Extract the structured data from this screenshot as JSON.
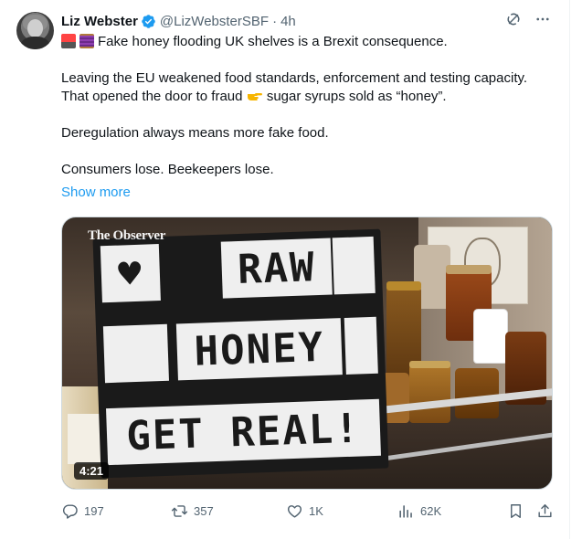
{
  "post": {
    "author_name": "Liz Webster",
    "handle": "@LizWebsterSBF",
    "separator": "·",
    "time": "4h",
    "line1": "Fake honey flooding UK shelves is a Brexit consequence.",
    "para2_before": "Leaving the EU weakened food standards, enforcement and testing capacity. That opened the door to fraud",
    "para2_after": "sugar syrups sold as “honey”.",
    "para3": "Deregulation always means more fake food.",
    "para4": "Consumers lose. Beekeepers lose.",
    "show_more": "Show more"
  },
  "media": {
    "watermark": "The Observer",
    "sign_rows": [
      "RAW",
      "HONEY",
      "GET REAL!"
    ],
    "duration": "4:21"
  },
  "actions": {
    "replies": "197",
    "reposts": "357",
    "likes": "1K",
    "views": "62K"
  },
  "colors": {
    "accent": "#1d9bf0",
    "muted": "#536471",
    "text": "#0f1419"
  },
  "icons": [
    "verified-badge-icon",
    "grok-icon",
    "more-icon",
    "siren-emoji-icon",
    "spool-emoji-icon",
    "pointing-hand-emoji-icon",
    "reply-icon",
    "repost-icon",
    "like-icon",
    "views-icon",
    "bookmark-icon",
    "share-icon"
  ]
}
